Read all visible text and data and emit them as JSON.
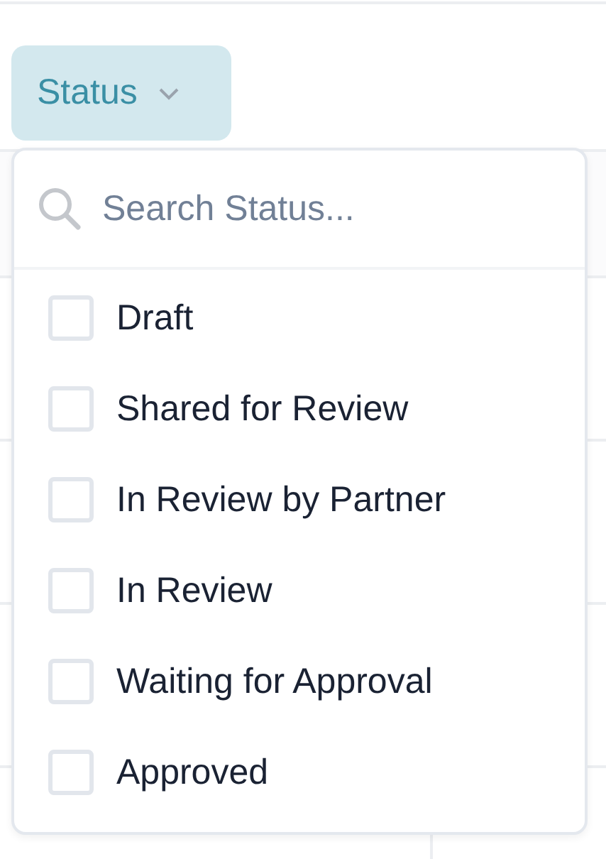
{
  "filter_button": {
    "label": "Status",
    "expanded": true
  },
  "dropdown": {
    "search": {
      "placeholder": "Search Status..."
    },
    "options": [
      {
        "label": "Draft",
        "checked": false
      },
      {
        "label": "Shared for Review",
        "checked": false
      },
      {
        "label": "In Review by Partner",
        "checked": false
      },
      {
        "label": "In Review",
        "checked": false
      },
      {
        "label": "Waiting for Approval",
        "checked": false
      },
      {
        "label": "Approved",
        "checked": false
      }
    ]
  }
}
